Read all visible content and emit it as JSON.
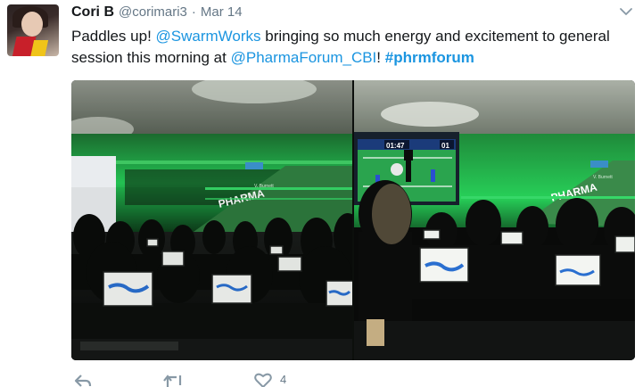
{
  "tweet": {
    "author_name": "Cori B",
    "author_handle": "@corimari3",
    "separator": "·",
    "date": "Mar 14",
    "text": {
      "part1": "Paddles up! ",
      "mention1": "@SwarmWorks",
      "part2": " bringing so much energy and excitement to general session this morning at ",
      "mention2": "@PharmaForum_CBI",
      "part3": "! ",
      "hashtag": "#phrmforum"
    },
    "media": {
      "left_photo": {
        "stage_banner": "PHARMA",
        "stage_sub": "V. Burnett"
      },
      "right_photo": {
        "screen_timer": "01:47",
        "screen_score": "01",
        "stage_banner": "PHARMA",
        "stage_sub": "V. Burnett"
      }
    },
    "actions": {
      "like_count": "4"
    },
    "colors": {
      "link": "#1b95e0",
      "secondary_text": "#657786",
      "stage_green": "#1fd45a"
    },
    "icons": [
      "caret-down-icon",
      "reply-icon",
      "retweet-icon",
      "like-icon"
    ]
  }
}
